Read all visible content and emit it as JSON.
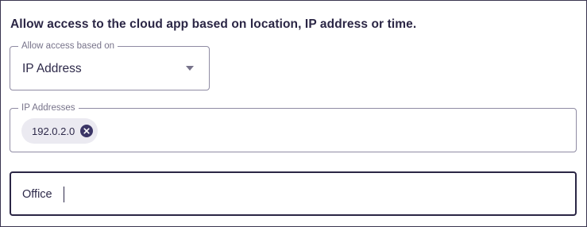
{
  "heading": "Allow access to the cloud app based on location, IP address or time.",
  "access_select": {
    "label": "Allow access based on",
    "value": "IP Address",
    "icon": "caret-down-icon"
  },
  "ip_addresses": {
    "label": "IP Addresses",
    "chips": [
      {
        "label": "192.0.2.0",
        "remove_icon": "close-circle-icon"
      }
    ]
  },
  "name_input": {
    "value": "Office"
  }
}
